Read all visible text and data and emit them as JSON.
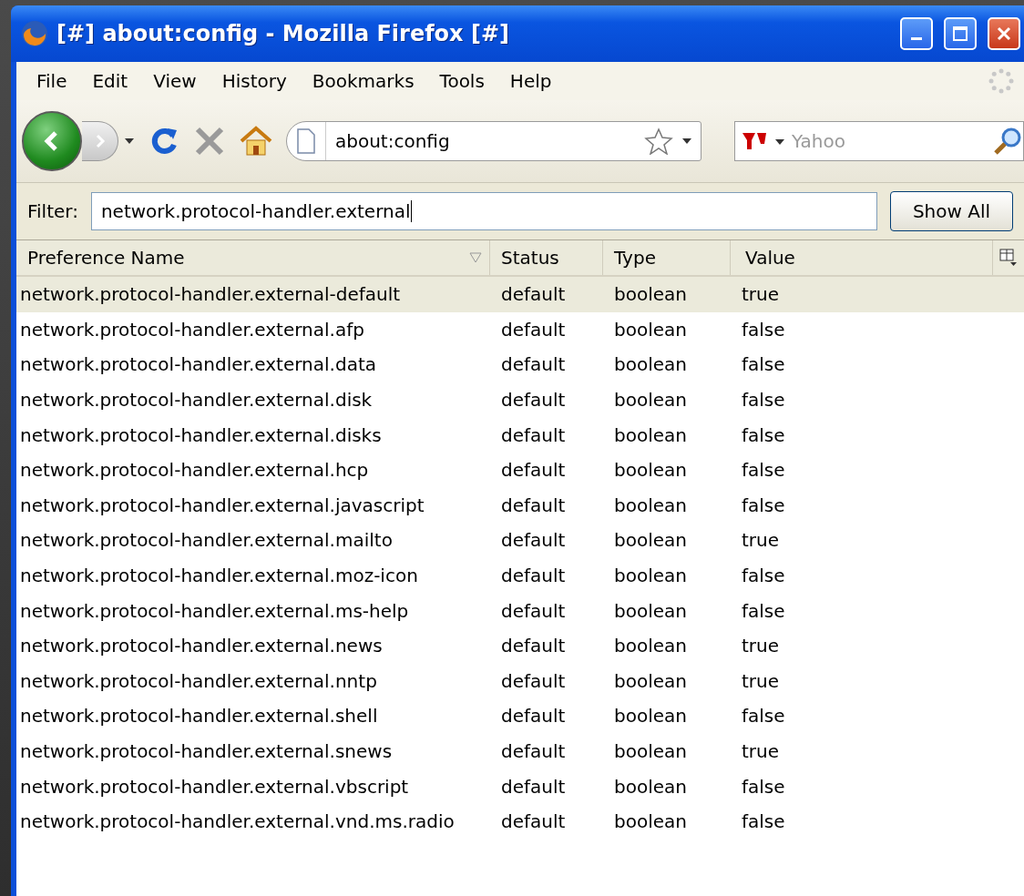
{
  "window": {
    "title": "[#] about:config - Mozilla Firefox [#]"
  },
  "menu": [
    "File",
    "Edit",
    "View",
    "History",
    "Bookmarks",
    "Tools",
    "Help"
  ],
  "address": {
    "value": "about:config"
  },
  "search": {
    "placeholder": "Yahoo"
  },
  "filter": {
    "label": "Filter:",
    "value": "network.protocol-handler.external",
    "button": "Show All"
  },
  "table": {
    "columns": [
      "Preference Name",
      "Status",
      "Type",
      "Value"
    ],
    "rows": [
      {
        "name": "network.protocol-handler.external-default",
        "status": "default",
        "type": "boolean",
        "value": "true",
        "selected": true
      },
      {
        "name": "network.protocol-handler.external.afp",
        "status": "default",
        "type": "boolean",
        "value": "false",
        "selected": false
      },
      {
        "name": "network.protocol-handler.external.data",
        "status": "default",
        "type": "boolean",
        "value": "false",
        "selected": false
      },
      {
        "name": "network.protocol-handler.external.disk",
        "status": "default",
        "type": "boolean",
        "value": "false",
        "selected": false
      },
      {
        "name": "network.protocol-handler.external.disks",
        "status": "default",
        "type": "boolean",
        "value": "false",
        "selected": false
      },
      {
        "name": "network.protocol-handler.external.hcp",
        "status": "default",
        "type": "boolean",
        "value": "false",
        "selected": false
      },
      {
        "name": "network.protocol-handler.external.javascript",
        "status": "default",
        "type": "boolean",
        "value": "false",
        "selected": false
      },
      {
        "name": "network.protocol-handler.external.mailto",
        "status": "default",
        "type": "boolean",
        "value": "true",
        "selected": false
      },
      {
        "name": "network.protocol-handler.external.moz-icon",
        "status": "default",
        "type": "boolean",
        "value": "false",
        "selected": false
      },
      {
        "name": "network.protocol-handler.external.ms-help",
        "status": "default",
        "type": "boolean",
        "value": "false",
        "selected": false
      },
      {
        "name": "network.protocol-handler.external.news",
        "status": "default",
        "type": "boolean",
        "value": "true",
        "selected": false
      },
      {
        "name": "network.protocol-handler.external.nntp",
        "status": "default",
        "type": "boolean",
        "value": "true",
        "selected": false
      },
      {
        "name": "network.protocol-handler.external.shell",
        "status": "default",
        "type": "boolean",
        "value": "false",
        "selected": false
      },
      {
        "name": "network.protocol-handler.external.snews",
        "status": "default",
        "type": "boolean",
        "value": "true",
        "selected": false
      },
      {
        "name": "network.protocol-handler.external.vbscript",
        "status": "default",
        "type": "boolean",
        "value": "false",
        "selected": false
      },
      {
        "name": "network.protocol-handler.external.vnd.ms.radio",
        "status": "default",
        "type": "boolean",
        "value": "false",
        "selected": false
      }
    ]
  }
}
